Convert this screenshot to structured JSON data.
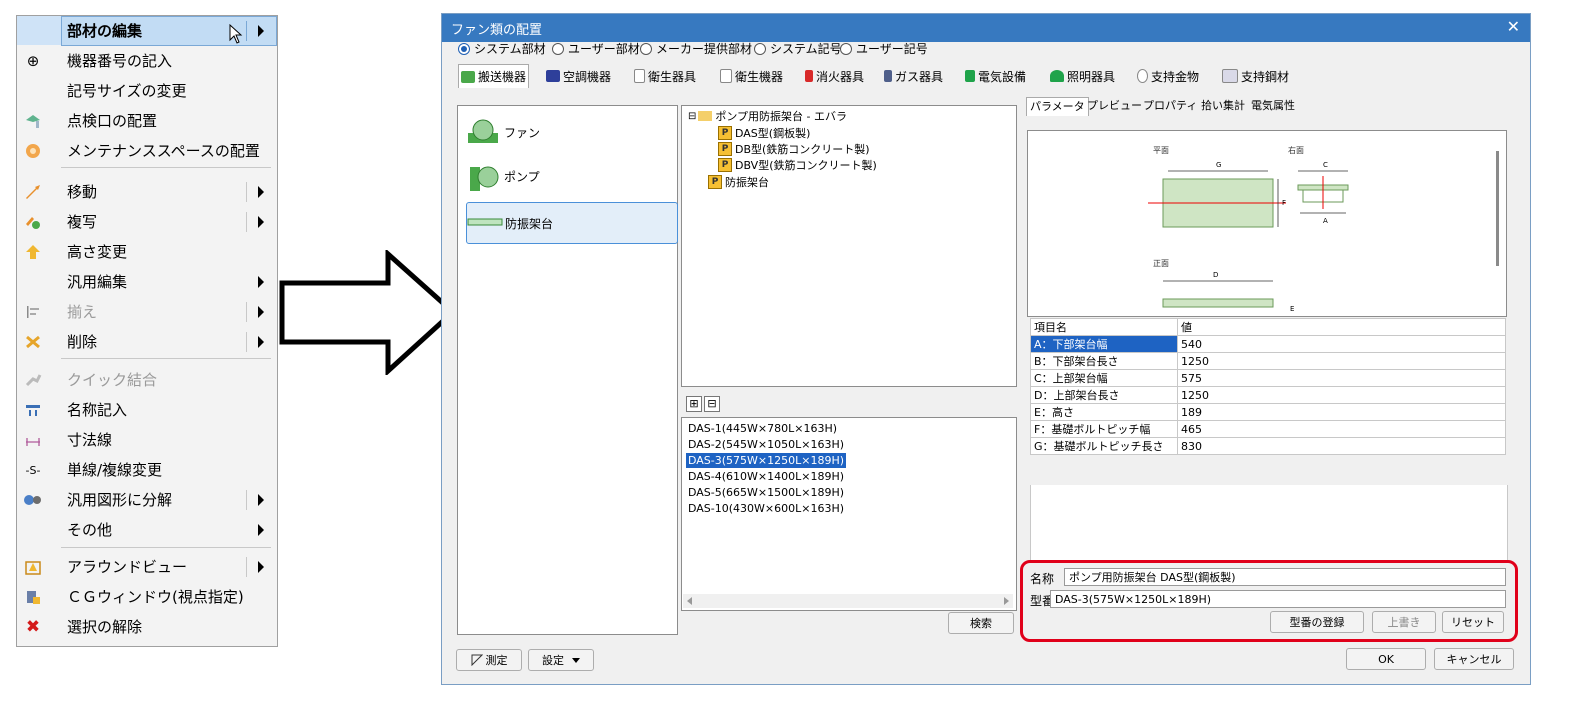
{
  "context_menu": {
    "items": [
      {
        "label": "部材の編集",
        "icon": "edit-member-icon",
        "submenu": true,
        "highlighted": true,
        "disabled": false
      },
      {
        "label": "機器番号の記入",
        "icon": "crosshair-circle-icon",
        "submenu": false,
        "disabled": false
      },
      {
        "label": "記号サイズの変更",
        "icon": "",
        "submenu": false,
        "disabled": false
      },
      {
        "label": "点検口の配置",
        "icon": "inspection-opening-icon",
        "submenu": false,
        "disabled": false
      },
      {
        "label": "メンテナンススペースの配置",
        "icon": "maintenance-space-icon",
        "submenu": false,
        "disabled": false
      },
      {
        "label": "移動",
        "icon": "move-icon",
        "submenu": true,
        "disabled": false
      },
      {
        "label": "複写",
        "icon": "copy-icon",
        "submenu": true,
        "disabled": false
      },
      {
        "label": "高さ変更",
        "icon": "height-change-icon",
        "submenu": false,
        "disabled": false
      },
      {
        "label": "汎用編集",
        "icon": "",
        "submenu": true,
        "disabled": false
      },
      {
        "label": "揃え",
        "icon": "align-icon",
        "submenu": true,
        "disabled": true
      },
      {
        "label": "削除",
        "icon": "delete-icon",
        "submenu": true,
        "disabled": false
      },
      {
        "label": "クイック結合",
        "icon": "quick-join-icon",
        "submenu": false,
        "disabled": true
      },
      {
        "label": "名称記入",
        "icon": "name-entry-icon",
        "submenu": false,
        "disabled": false
      },
      {
        "label": "寸法線",
        "icon": "dimension-line-icon",
        "submenu": false,
        "disabled": false
      },
      {
        "label": "単線/複線変更",
        "icon": "single-double-line-icon",
        "submenu": false,
        "disabled": false
      },
      {
        "label": "汎用図形に分解",
        "icon": "explode-icon",
        "submenu": true,
        "disabled": false
      },
      {
        "label": "その他",
        "icon": "",
        "submenu": true,
        "disabled": false
      },
      {
        "label": "アラウンドビュー",
        "icon": "around-view-icon",
        "submenu": true,
        "disabled": false
      },
      {
        "label": "ＣＧウィンドウ(視点指定)",
        "icon": "cg-window-icon",
        "submenu": false,
        "disabled": false
      },
      {
        "label": "選択の解除",
        "icon": "deselect-icon",
        "submenu": false,
        "disabled": false
      }
    ],
    "icon_glyphs": {
      "crosshair": "⊕",
      "red_x": "✖",
      "s_line": "-S-"
    }
  },
  "dialog": {
    "title": "ファン類の配置",
    "close": "✕",
    "radios": [
      "システム部材",
      "ユーザー部材",
      "メーカー提供部材",
      "システム記号",
      "ユーザー記号"
    ],
    "tabs": [
      "搬送機器",
      "空調機器",
      "衛生器具",
      "衛生機器",
      "消火器具",
      "ガス器具",
      "電気設備",
      "照明器具",
      "支持金物",
      "支持鋼材"
    ],
    "categories": [
      "ファン",
      "ポンプ",
      "防振架台"
    ],
    "tree": {
      "root": "ポンプ用防振架台 - エバラ",
      "children": [
        "DAS型(鋼板製)",
        "DB型(鉄筋コンクリート製)",
        "DBV型(鉄筋コンクリート製)"
      ],
      "sibling": "防振架台",
      "badge": "P"
    },
    "expand_buttons": [
      "⊞",
      "⊟"
    ],
    "models": [
      "DAS-1(445W×780L×163H)",
      "DAS-2(545W×1050L×163H)",
      "DAS-3(575W×1250L×189H)",
      "DAS-4(610W×1400L×189H)",
      "DAS-5(665W×1500L×189H)",
      "DAS-10(430W×600L×163H)"
    ],
    "search_button": "検索",
    "right_tabs": [
      "パラメータ",
      "プレビュー",
      "プロパティ",
      "拾い集計",
      "電気属性"
    ],
    "diagram": {
      "plan_label": "平面",
      "side_label": "右面",
      "front_label": "正面",
      "dims": {
        "g": "G",
        "c": "C",
        "f": "F",
        "a": "A",
        "d": "D",
        "e": "E"
      }
    },
    "param_headers": [
      "項目名",
      "値"
    ],
    "params": [
      [
        "A：下部架台幅",
        "540"
      ],
      [
        "B：下部架台長さ",
        "1250"
      ],
      [
        "C：上部架台幅",
        "575"
      ],
      [
        "D：上部架台長さ",
        "1250"
      ],
      [
        "E：高さ",
        "189"
      ],
      [
        "F：基礎ボルトピッチ幅",
        "465"
      ],
      [
        "G：基礎ボルトピッチ長さ",
        "830"
      ]
    ],
    "name_label": "名称",
    "name_value": "ポンプ用防振架台 DAS型(鋼板製)",
    "model_label": "型番",
    "model_value": "DAS-3(575W×1250L×189H)",
    "register_button": "型番の登録",
    "overwrite_button": "上書き",
    "reset_button": "リセット",
    "measure_button": "測定",
    "settings_button": "設定",
    "ok_button": "OK",
    "cancel_button": "キャンセル"
  }
}
